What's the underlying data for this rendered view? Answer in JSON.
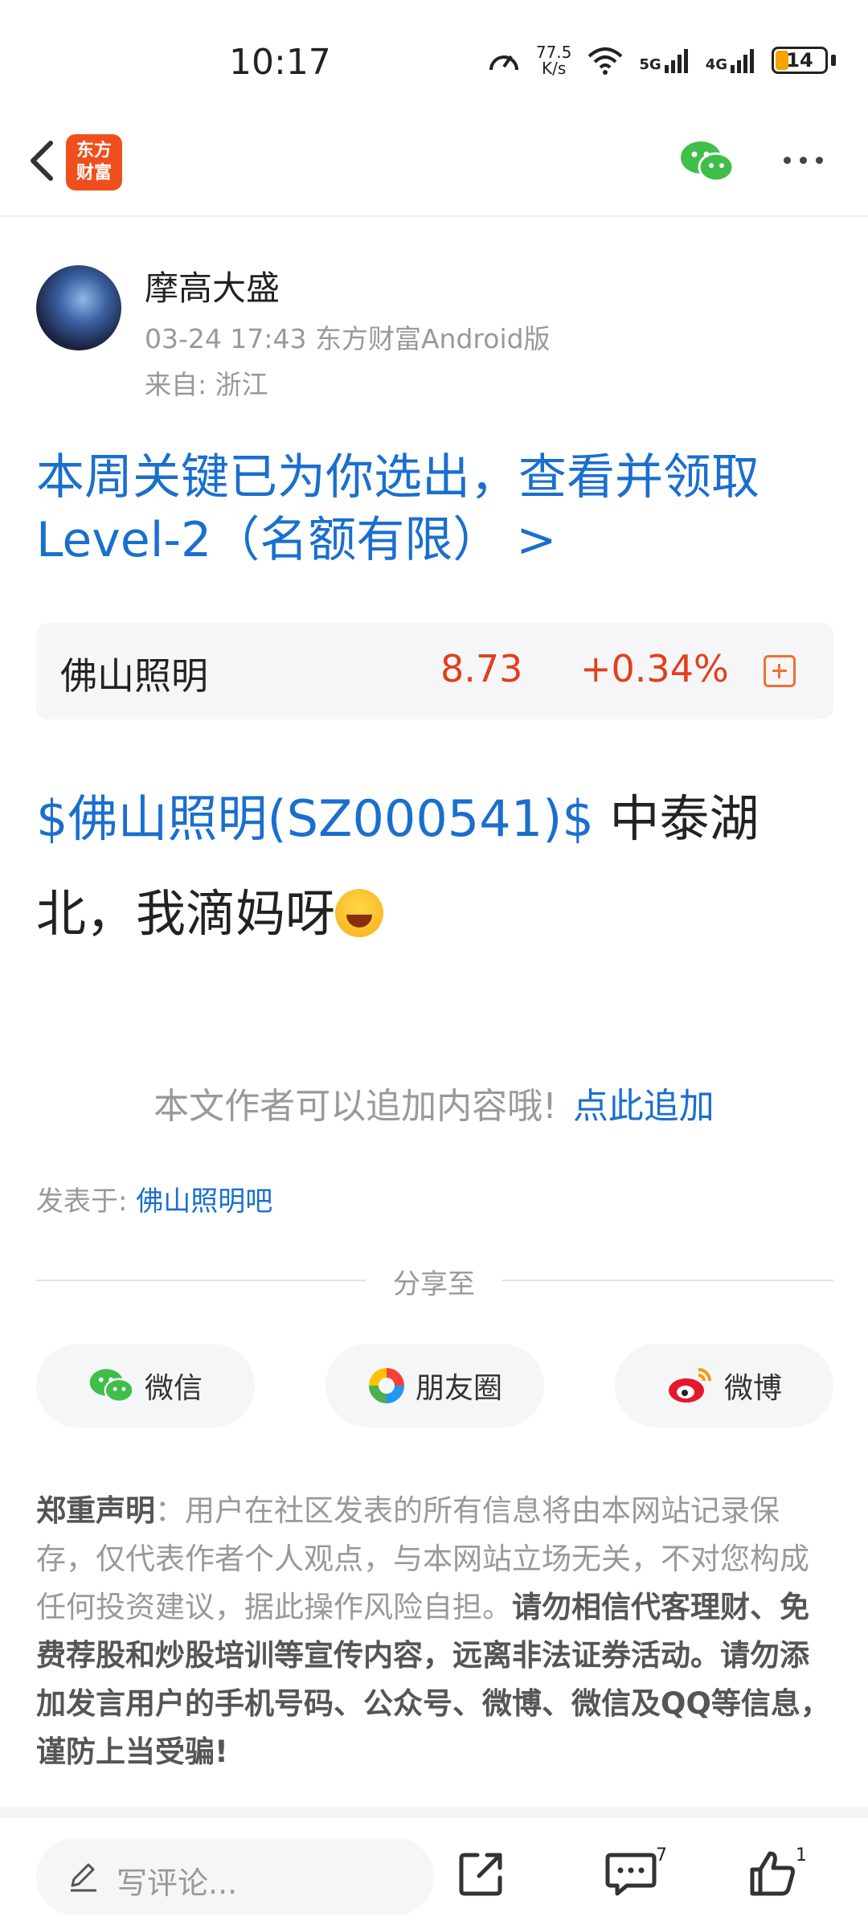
{
  "status_bar": {
    "time": "10:17",
    "speed_value": "77.5",
    "speed_unit": "K/s",
    "net_5g": "5G",
    "net_4g": "4G",
    "battery": "14"
  },
  "header": {
    "logo_line1": "东方",
    "logo_line2": "财富"
  },
  "author": {
    "name": "摩高大盛",
    "meta": "03-24 17:43 东方财富Android版",
    "from": "来自: 浙江"
  },
  "promo": {
    "text": "本周关键已为你选出，查看并领取Level-2（名额有限） >"
  },
  "stock": {
    "name": "佛山照明",
    "price": "8.73",
    "change": "+0.34%"
  },
  "post": {
    "tag": "$佛山照明(SZ000541)$",
    "text": " 中泰湖北，我滴妈呀"
  },
  "append": {
    "text": "本文作者可以追加内容哦!",
    "link": "点此追加"
  },
  "posted_in": {
    "label": "发表于: ",
    "bar": "佛山照明吧"
  },
  "share": {
    "title": "分享至",
    "wechat": "微信",
    "moments": "朋友圈",
    "weibo": "微博"
  },
  "disclaimer": {
    "title": "郑重声明",
    "normal": "：用户在社区发表的所有信息将由本网站记录保存，仅代表作者个人观点，与本网站立场无关，不对您构成任何投资建议，据此操作风险自担。",
    "bold": "请勿相信代客理财、免费荐股和炒股培训等宣传内容，远离非法证券活动。请勿添加发言用户的手机号码、公众号、微博、微信及QQ等信息，谨防上当受骗!"
  },
  "bottom_bar": {
    "comment_placeholder": "写评论...",
    "comment_count": "7",
    "like_count": "1"
  },
  "colors": {
    "link_blue": "#1a6fce",
    "stock_red": "#e0401a",
    "brand_orange": "#f04f1d"
  }
}
